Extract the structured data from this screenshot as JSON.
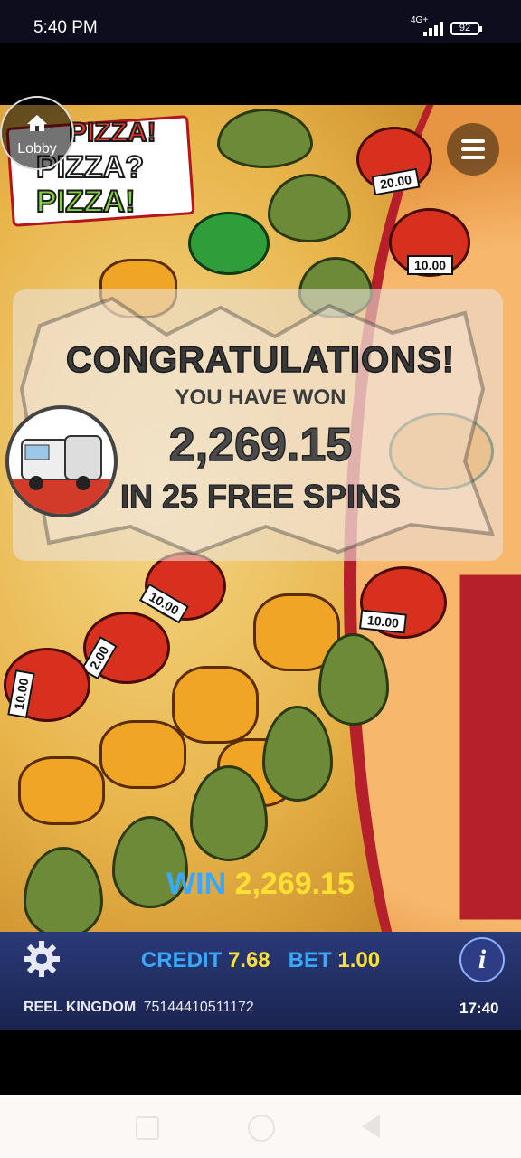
{
  "status_bar": {
    "time": "5:40 PM",
    "network": "4G+",
    "battery": "92"
  },
  "lobby": {
    "label": "Lobby"
  },
  "logo": {
    "line1": "PIZZA!",
    "line2": "PIZZA?",
    "line3": "PIZZA!"
  },
  "symbol_tags": [
    "20.00",
    "10.00",
    "10.00",
    "10.00",
    "10.00",
    "2.00",
    "10.00"
  ],
  "popup": {
    "title": "CONGRATULATIONS!",
    "subtitle": "YOU HAVE WON",
    "amount": "2,269.15",
    "spins_text": "IN 25 FREE SPINS"
  },
  "win": {
    "label": "WIN",
    "value": "2,269.15"
  },
  "footer": {
    "credit_label": "CREDIT",
    "credit_value": "7.68",
    "bet_label": "BET",
    "bet_value": "1.00",
    "brand": "REEL KINGDOM",
    "round_id": "75144410511172",
    "clock": "17:40",
    "info_glyph": "i"
  },
  "colors": {
    "win_label": "#39a8ff",
    "win_value": "#ffe033",
    "bar": "#2a3a78"
  }
}
